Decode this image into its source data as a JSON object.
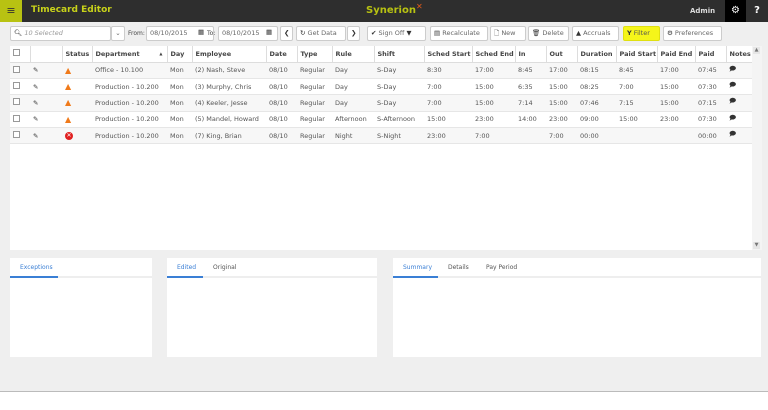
{
  "header": {
    "title": "Timecard Editor",
    "logo": "Synerion",
    "user": "Admin",
    "menu_icon": "hamburger-icon",
    "settings_icon": "gear-icon",
    "help_label": "?"
  },
  "toolbar": {
    "selector_value": "10 Selected",
    "from_label": "From:",
    "from_value": "08/10/2015",
    "to_label": "To:",
    "to_value": "08/10/2015",
    "get_data": "Get Data",
    "sign_off": "Sign Off",
    "recalculate": "Recalculate",
    "new": "New",
    "delete": "Delete",
    "accruals": "Accruals",
    "filter": "Filter",
    "preferences": "Preferences",
    "filter_color": "#f5f51a"
  },
  "grid": {
    "columns": [
      "",
      "",
      "Status",
      "Department",
      "Day",
      "Employee",
      "Date",
      "Type",
      "Rule",
      "Shift",
      "Sched Start",
      "Sched End",
      "In",
      "Out",
      "Duration",
      "Paid Start",
      "Paid End",
      "Paid",
      "Notes"
    ],
    "rows": [
      {
        "status": "warning",
        "department": "Office - 10.100",
        "day": "Mon",
        "employee": "(2) Nash, Steve",
        "date": "08/10",
        "type": "Regular",
        "rule": "Day",
        "shift": "S-Day",
        "sched_start": "8:30",
        "sched_end": "17:00",
        "in": "8:45",
        "out": "17:00",
        "duration": "08:15",
        "paid_start": "8:45",
        "paid_end": "17:00",
        "paid": "07:45"
      },
      {
        "status": "warning",
        "department": "Production - 10.200",
        "day": "Mon",
        "employee": "(3) Murphy, Chris",
        "date": "08/10",
        "type": "Regular",
        "rule": "Day",
        "shift": "S-Day",
        "sched_start": "7:00",
        "sched_end": "15:00",
        "in": "6:35",
        "out": "15:00",
        "duration": "08:25",
        "paid_start": "7:00",
        "paid_end": "15:00",
        "paid": "07:30"
      },
      {
        "status": "warning",
        "department": "Production - 10.200",
        "day": "Mon",
        "employee": "(4) Keeler, Jesse",
        "date": "08/10",
        "type": "Regular",
        "rule": "Day",
        "shift": "S-Day",
        "sched_start": "7:00",
        "sched_end": "15:00",
        "in": "7:14",
        "out": "15:00",
        "duration": "07:46",
        "paid_start": "7:15",
        "paid_end": "15:00",
        "paid": "07:15"
      },
      {
        "status": "warning",
        "department": "Production - 10.200",
        "day": "Mon",
        "employee": "(5) Mandel, Howard",
        "date": "08/10",
        "type": "Regular",
        "rule": "Afternoon",
        "shift": "S-Afternoon",
        "sched_start": "15:00",
        "sched_end": "23:00",
        "in": "14:00",
        "out": "23:00",
        "duration": "09:00",
        "paid_start": "15:00",
        "paid_end": "23:00",
        "paid": "07:30"
      },
      {
        "status": "error",
        "department": "Production - 10.200",
        "day": "Mon",
        "employee": "(7) King, Brian",
        "date": "08/10",
        "type": "Regular",
        "rule": "Night",
        "shift": "S-Night",
        "sched_start": "23:00",
        "sched_end": "7:00",
        "in": "",
        "out": "7:00",
        "duration": "00:00",
        "paid_start": "",
        "paid_end": "",
        "paid": "00:00"
      }
    ]
  },
  "panels": {
    "exceptions": {
      "tabs": [
        "Exceptions"
      ]
    },
    "edits": {
      "tabs": [
        "Edited",
        "Original"
      ]
    },
    "summary": {
      "tabs": [
        "Summary",
        "Details",
        "Pay Period"
      ]
    }
  }
}
